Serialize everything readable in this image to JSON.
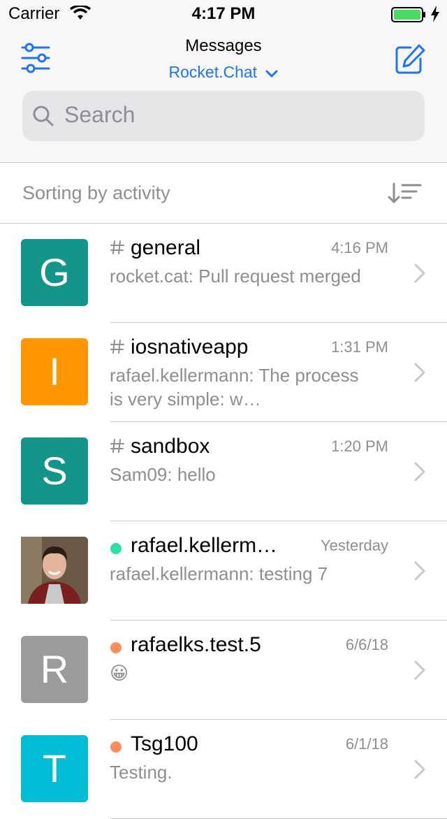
{
  "status_bar": {
    "carrier": "Carrier",
    "time": "4:17 PM"
  },
  "header": {
    "title": "Messages",
    "server": "Rocket.Chat"
  },
  "search": {
    "placeholder": "Search"
  },
  "sorting": {
    "label": "Sorting by activity"
  },
  "colors": {
    "accent": "#1d74f5",
    "secondary_text": "#8e8e93",
    "online": "#2de0a5",
    "away": "#ff8c5a",
    "avatar_teal": "#13958a",
    "avatar_orange": "#ff9600",
    "avatar_gray": "#9b9b9b",
    "avatar_cyan": "#00bcd4"
  },
  "rooms": [
    {
      "avatar_letter": "G",
      "avatar_color": "#13958a",
      "type": "channel",
      "name": "general",
      "time": "4:16 PM",
      "preview": "rocket.cat: Pull request merged"
    },
    {
      "avatar_letter": "I",
      "avatar_color": "#ff9600",
      "type": "channel",
      "name": "iosnativeapp",
      "time": "1:31 PM",
      "preview": "rafael.kellermann: The process is very simple: w…"
    },
    {
      "avatar_letter": "S",
      "avatar_color": "#13958a",
      "type": "channel",
      "name": "sandbox",
      "time": "1:20 PM",
      "preview": "Sam09: hello"
    },
    {
      "avatar_letter": "",
      "avatar_color": "#5a4a3a",
      "type": "dm",
      "status": "online",
      "name": "rafael.kellerm…",
      "time": "Yesterday",
      "preview": "rafael.kellermann: testing 7"
    },
    {
      "avatar_letter": "R",
      "avatar_color": "#9b9b9b",
      "type": "dm",
      "status": "away",
      "name": "rafaelks.test.5",
      "time": "6/6/18",
      "preview": "😀"
    },
    {
      "avatar_letter": "T",
      "avatar_color": "#00bcd4",
      "type": "dm",
      "status": "away",
      "name": "Tsg100",
      "time": "6/1/18",
      "preview": "Testing."
    }
  ]
}
